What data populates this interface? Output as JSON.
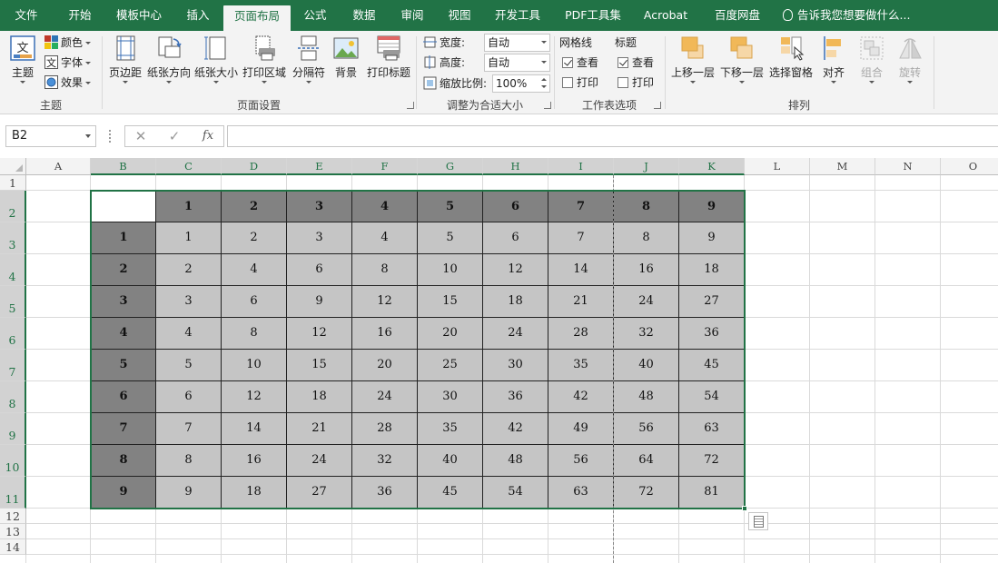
{
  "tabs": [
    {
      "label": "文件",
      "active": false
    },
    {
      "label": "开始",
      "active": false
    },
    {
      "label": "模板中心",
      "active": false
    },
    {
      "label": "插入",
      "active": false
    },
    {
      "label": "页面布局",
      "active": true
    },
    {
      "label": "公式",
      "active": false
    },
    {
      "label": "数据",
      "active": false
    },
    {
      "label": "审阅",
      "active": false
    },
    {
      "label": "视图",
      "active": false
    },
    {
      "label": "开发工具",
      "active": false
    },
    {
      "label": "PDF工具集",
      "active": false
    },
    {
      "label": "Acrobat",
      "active": false
    },
    {
      "label": "百度网盘",
      "active": false
    }
  ],
  "tell_me": "告诉我您想要做什么...",
  "ribbon": {
    "theme": {
      "group": "主题",
      "theme_btn": "主题",
      "colors": "颜色",
      "fonts": "字体",
      "effects": "效果",
      "fonts_icon_glyph": "文"
    },
    "page_setup": {
      "group": "页面设置",
      "margins": "页边距",
      "orientation": "纸张方向",
      "size": "纸张大小",
      "print_area": "打印区域",
      "breaks": "分隔符",
      "background": "背景",
      "print_titles": "打印标题"
    },
    "scale": {
      "group": "调整为合适大小",
      "width_label": "宽度:",
      "width_value": "自动",
      "height_label": "高度:",
      "height_value": "自动",
      "scale_label": "缩放比例:",
      "scale_value": "100%"
    },
    "sheet_options": {
      "group": "工作表选项",
      "gridlines": "网格线",
      "headings": "标题",
      "view": "查看",
      "print": "打印",
      "gridlines_view": true,
      "gridlines_print": false,
      "headings_view": true,
      "headings_print": false
    },
    "arrange": {
      "group": "排列",
      "bring_forward": "上移一层",
      "send_backward": "下移一层",
      "selection_pane": "选择窗格",
      "align": "对齐",
      "group_btn": "组合",
      "rotate": "旋转"
    }
  },
  "formula_bar": {
    "name_box": "B2",
    "cancel_glyph": "✕",
    "enter_glyph": "✓",
    "fx": "fx",
    "value": ""
  },
  "columns": [
    "A",
    "B",
    "C",
    "D",
    "E",
    "F",
    "G",
    "H",
    "I",
    "J",
    "K",
    "L",
    "M",
    "N",
    "O"
  ],
  "rows": [
    "1",
    "2",
    "3",
    "4",
    "5",
    "6",
    "7",
    "8",
    "9",
    "10",
    "11",
    "12",
    "13",
    "14"
  ],
  "table": {
    "header_row": [
      "",
      "1",
      "2",
      "3",
      "4",
      "5",
      "6",
      "7",
      "8",
      "9"
    ],
    "body": [
      [
        "1",
        "1",
        "2",
        "3",
        "4",
        "5",
        "6",
        "7",
        "8",
        "9"
      ],
      [
        "2",
        "2",
        "4",
        "6",
        "8",
        "10",
        "12",
        "14",
        "16",
        "18"
      ],
      [
        "3",
        "3",
        "6",
        "9",
        "12",
        "15",
        "18",
        "21",
        "24",
        "27"
      ],
      [
        "4",
        "4",
        "8",
        "12",
        "16",
        "20",
        "24",
        "28",
        "32",
        "36"
      ],
      [
        "5",
        "5",
        "10",
        "15",
        "20",
        "25",
        "30",
        "35",
        "40",
        "45"
      ],
      [
        "6",
        "6",
        "12",
        "18",
        "24",
        "30",
        "36",
        "42",
        "48",
        "54"
      ],
      [
        "7",
        "7",
        "14",
        "21",
        "28",
        "35",
        "42",
        "49",
        "56",
        "63"
      ],
      [
        "8",
        "8",
        "16",
        "24",
        "32",
        "40",
        "48",
        "56",
        "64",
        "72"
      ],
      [
        "9",
        "9",
        "18",
        "27",
        "36",
        "45",
        "54",
        "63",
        "72",
        "81"
      ]
    ]
  },
  "colors": {
    "accent": "#217346",
    "header_fill": "#828282",
    "data_fill": "#c5c5c5"
  }
}
